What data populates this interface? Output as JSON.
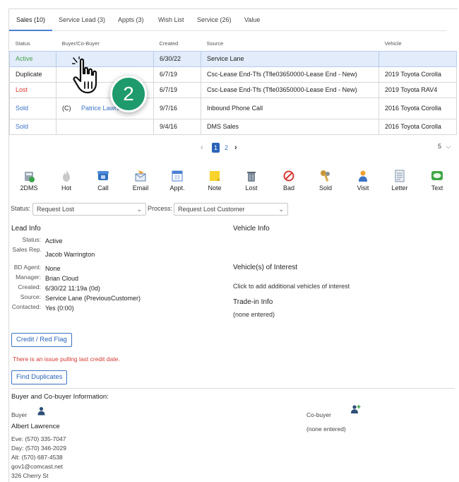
{
  "tabs": [
    {
      "label": "Sales (10)",
      "active": true
    },
    {
      "label": "Service Lead (3)"
    },
    {
      "label": "Appts (3)"
    },
    {
      "label": "Wish List"
    },
    {
      "label": "Service (26)"
    },
    {
      "label": "Value"
    }
  ],
  "table": {
    "headers": [
      "Status",
      "Buyer/Co-Buyer",
      "Created",
      "Source",
      "Vehicle"
    ],
    "rows": [
      {
        "status": "Active",
        "status_color": "#4aa24a",
        "buyer_prefix": "",
        "buyer": "",
        "created": "6/30/22",
        "source": "Service Lane",
        "vehicle": ""
      },
      {
        "status": "Duplicate",
        "status_color": "#222222",
        "buyer_prefix": "",
        "buyer": "",
        "created": "6/7/19",
        "source": "Csc-Lease End-Tfs (Tfle03650000-Lease End - New)",
        "vehicle": "2019 Toyota Corolla"
      },
      {
        "status": "Lost",
        "status_color": "#d43a32",
        "buyer_prefix": "",
        "buyer": "",
        "created": "6/7/19",
        "source": "Csc-Lease End-Tfs (Tfle03650000-Lease End - New)",
        "vehicle": "2019 Toyota RAV4"
      },
      {
        "status": "Sold",
        "status_color": "#3b73c4",
        "buyer_prefix": "(C)",
        "buyer": "Patrice Lawre",
        "created": "9/7/16",
        "source": "Inbound Phone Call",
        "vehicle": "2016 Toyota Corolla"
      },
      {
        "status": "Sold",
        "status_color": "#3b73c4",
        "buyer_prefix": "",
        "buyer": "",
        "created": "9/4/16",
        "source": "DMS Sales",
        "vehicle": "2016 Toyota Corolla"
      }
    ]
  },
  "pagination": {
    "prev": "‹",
    "pages": [
      "1",
      "2"
    ],
    "current": "1",
    "next": "›",
    "per_page": "5"
  },
  "actions": [
    {
      "label": "2DMS",
      "icon": "dms-icon"
    },
    {
      "label": "Hot",
      "icon": "flame-icon"
    },
    {
      "label": "Call",
      "icon": "phone-icon"
    },
    {
      "label": "Email",
      "icon": "email-icon"
    },
    {
      "label": "Appt.",
      "icon": "calendar-icon"
    },
    {
      "label": "Note",
      "icon": "note-icon"
    },
    {
      "label": "Lost",
      "icon": "trash-icon"
    },
    {
      "label": "Bad",
      "icon": "prohibited-icon"
    },
    {
      "label": "Sold",
      "icon": "keys-icon"
    },
    {
      "label": "Visit",
      "icon": "person-icon"
    },
    {
      "label": "Letter",
      "icon": "letter-icon"
    },
    {
      "label": "Text",
      "icon": "chat-icon"
    }
  ],
  "status_row": {
    "status_label": "Status:",
    "status_value": "Request Lost",
    "process_label": "Process:",
    "process_value": "Request Lost Customer"
  },
  "lead_info": {
    "title": "Lead Info",
    "fields": [
      {
        "key": "Status:",
        "value": "Active"
      },
      {
        "key": "Sales Rep.",
        "value": "Jacob Warrington"
      },
      {
        "key": "BD Agent:",
        "value": "None"
      },
      {
        "key": "Manager:",
        "value": "Brian Cloud"
      },
      {
        "key": "Created:",
        "value": "6/30/22 11:19a (0d)"
      },
      {
        "key": "Source:",
        "value": "Service Lane (PreviousCustomer)"
      },
      {
        "key": "Contacted:",
        "value": "Yes (0:00)"
      }
    ]
  },
  "vehicle_info": {
    "title": "Vehicle Info",
    "interest_title": "Vehicle(s) of Interest",
    "interest_hint": "Click to add additional vehicles of interest",
    "trade_title": "Trade-in Info",
    "trade_value": "(none entered)"
  },
  "credit_button": "Credit / Red Flag",
  "credit_warning": "There is an issue pulling last credit date.",
  "find_duplicates_button": "Find Duplicates",
  "buyer_section": {
    "title": "Buyer and Co-buyer Information:",
    "buyer_label": "Buyer",
    "buyer_name": "Albert Lawrence",
    "contacts": [
      "Eve: (570) 335-7047",
      "Day: (570) 346-2029",
      "Alt: (570) 687-4538",
      "gov1@comcast.net",
      "326 Cherry St"
    ],
    "cobuyer_label": "Co-buyer",
    "cobuyer_value": "(none entered)"
  },
  "overlay": {
    "step_number": "2",
    "cursor_icon": "hand-pointer-icon"
  },
  "colors": {
    "accent": "#3b73c4",
    "active": "#4aa24a",
    "lost": "#d43a32",
    "badge": "#1f9a6c",
    "highlight": "#e2ecfa"
  }
}
